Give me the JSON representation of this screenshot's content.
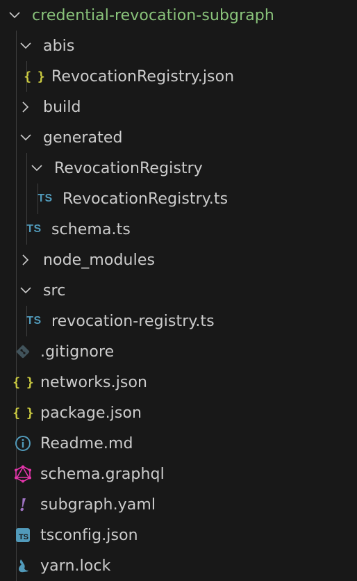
{
  "explorer": {
    "root": {
      "label": "credential-revocation-subgraph",
      "expanded": true
    },
    "items": [
      {
        "label": "abis",
        "type": "folder",
        "expanded": true
      },
      {
        "label": "RevocationRegistry.json",
        "type": "json"
      },
      {
        "label": "build",
        "type": "folder",
        "expanded": false
      },
      {
        "label": "generated",
        "type": "folder",
        "expanded": true
      },
      {
        "label": "RevocationRegistry",
        "type": "folder",
        "expanded": true
      },
      {
        "label": "RevocationRegistry.ts",
        "type": "ts"
      },
      {
        "label": "schema.ts",
        "type": "ts"
      },
      {
        "label": "node_modules",
        "type": "folder",
        "expanded": false
      },
      {
        "label": "src",
        "type": "folder",
        "expanded": true
      },
      {
        "label": "revocation-registry.ts",
        "type": "ts"
      },
      {
        "label": ".gitignore",
        "type": "git"
      },
      {
        "label": "networks.json",
        "type": "json"
      },
      {
        "label": "package.json",
        "type": "json"
      },
      {
        "label": "Readme.md",
        "type": "info"
      },
      {
        "label": "schema.graphql",
        "type": "graphql"
      },
      {
        "label": "subgraph.yaml",
        "type": "yaml"
      },
      {
        "label": "tsconfig.json",
        "type": "tsconfig"
      },
      {
        "label": "yarn.lock",
        "type": "yarn"
      }
    ],
    "icon_text": {
      "json": "{ }",
      "ts": "TS",
      "tsconfig": "TS",
      "yaml": "!"
    },
    "colors": {
      "background": "#181818",
      "text": "#cccccc",
      "root_text": "#89c27a",
      "json": "#cbcb41",
      "ts": "#519aba",
      "git": "#41535b",
      "info": "#519aba",
      "graphql": "#e535ab",
      "yaml": "#a074c4",
      "yarn": "#519aba",
      "guide": "#3e3e3e"
    }
  }
}
